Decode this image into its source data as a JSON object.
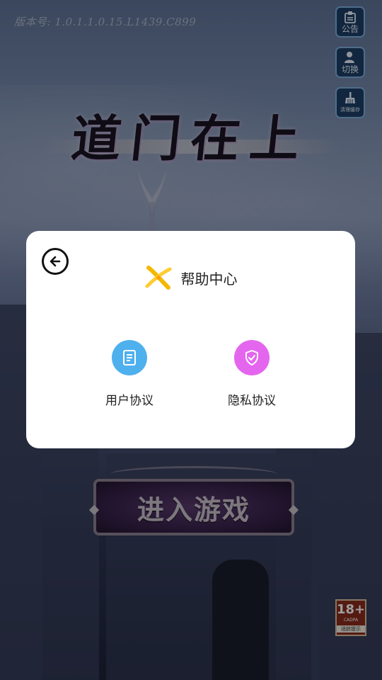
{
  "version_text": "版本号: 1.0.1.1.0.15.L1439.C899",
  "side_buttons": {
    "notice": {
      "label": "公告",
      "icon": "notice-board-icon"
    },
    "switch": {
      "label": "切换",
      "icon": "switch-account-icon"
    },
    "clear_cache": {
      "label": "清理缓存",
      "icon": "broom-icon"
    }
  },
  "game_logo": "道门在上",
  "start_button": "进入游戏",
  "age_rating": {
    "badge": "18+",
    "org": "CADPA",
    "caption": "适龄提示"
  },
  "help_dialog": {
    "title": "帮助中心",
    "back_icon": "back-arrow-icon",
    "options": [
      {
        "label": "用户协议",
        "icon": "document-icon",
        "color": "#4fb0ee"
      },
      {
        "label": "隐私协议",
        "icon": "shield-check-icon",
        "color": "#e466ee"
      }
    ]
  }
}
